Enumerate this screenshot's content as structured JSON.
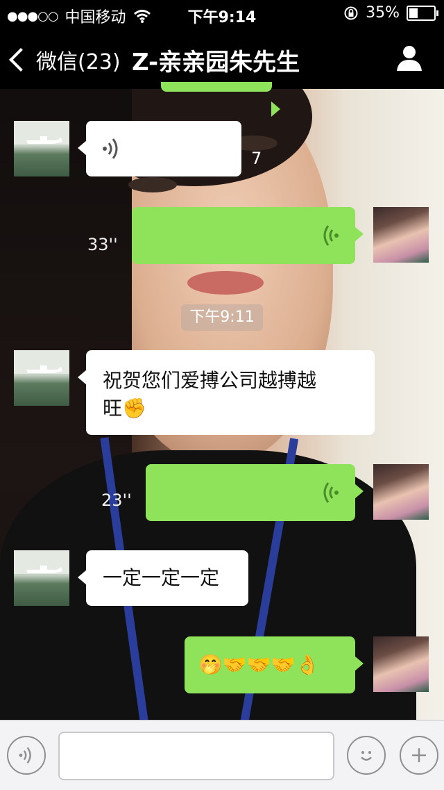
{
  "status_bar": {
    "signal": "●●●○○",
    "carrier": "中国移动",
    "time": "下午9:14",
    "battery": "35%",
    "battery_level": 0.35
  },
  "nav": {
    "back_label": "微信(23)",
    "title": "Z-亲亲园朱先生"
  },
  "messages": [
    {
      "direction": "in",
      "type": "voice",
      "duration": "7"
    },
    {
      "direction": "out",
      "type": "voice",
      "duration": "33''"
    },
    {
      "type": "timestamp",
      "text": "下午9:11"
    },
    {
      "direction": "in",
      "type": "text",
      "line1": "祝贺您们爱搏公司越搏越",
      "line2": "旺✊"
    },
    {
      "direction": "out",
      "type": "voice",
      "duration": "23''"
    },
    {
      "direction": "in",
      "type": "text",
      "text": "一定一定一定"
    },
    {
      "direction": "out",
      "type": "emoji",
      "text": "🤭🤝🤝🤝👌"
    }
  ],
  "input": {
    "placeholder": ""
  },
  "colors": {
    "outgoing_bubble": "#8ee35a",
    "incoming_bubble": "#ffffff",
    "bar": "#000000"
  }
}
